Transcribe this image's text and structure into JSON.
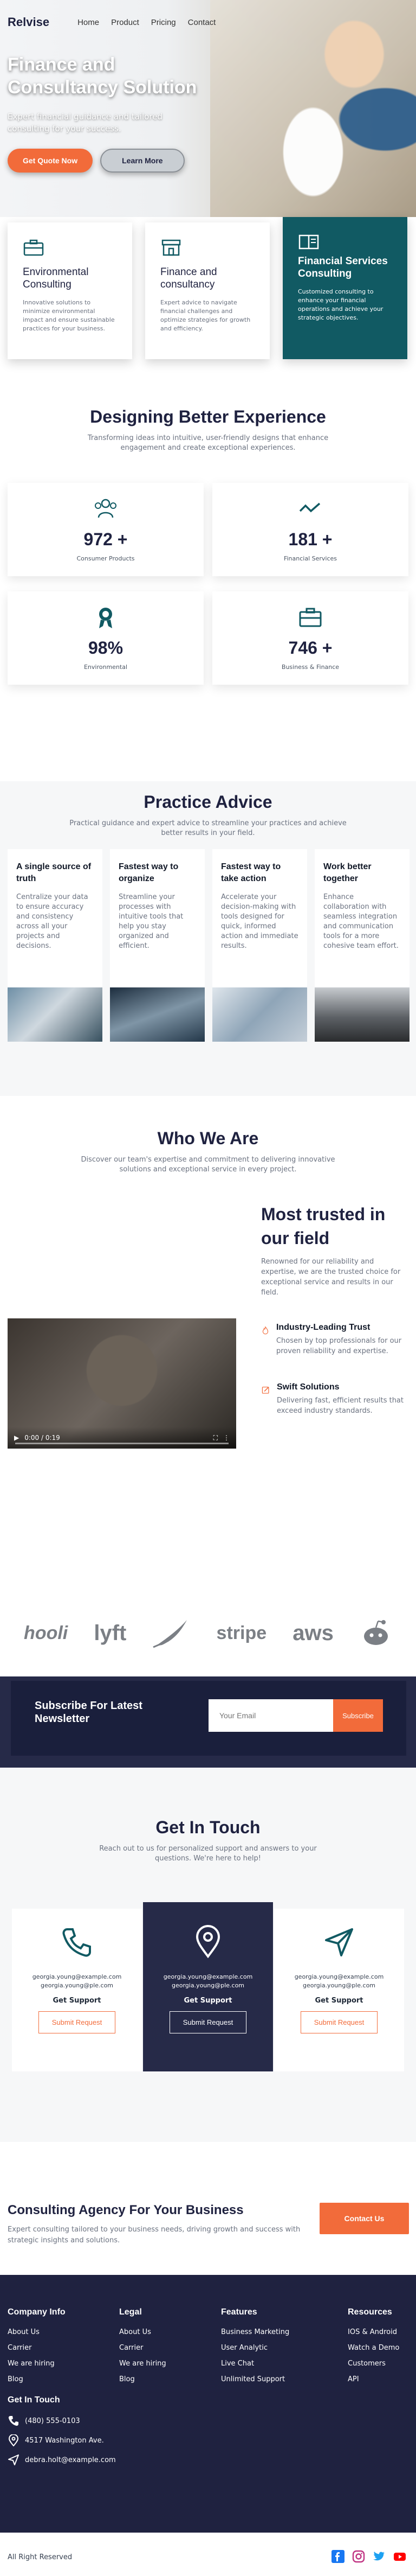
{
  "colors": {
    "navy": "#1f2240",
    "orange": "#f26b3a",
    "teal": "#115a63"
  },
  "header": {
    "logo": "Relvise",
    "nav": [
      "Home",
      "Product",
      "Pricing",
      "Contact"
    ]
  },
  "hero": {
    "title": "Finance and Consultancy Solution",
    "subtitle": "Expert financial guidance and tailored consulting for your success.",
    "primary_button": "Get Quote Now",
    "secondary_button": "Learn More"
  },
  "services": [
    {
      "icon": "briefcase-icon",
      "title": "Environmental Consulting",
      "text": "Innovative solutions to minimize environmental impact and ensure sustainable practices for your business."
    },
    {
      "icon": "store-icon",
      "title": "Finance and consultancy",
      "text": "Expert advice to navigate financial challenges and optimize strategies for growth and efficiency."
    },
    {
      "icon": "book-icon",
      "title": "Financial Services Consulting",
      "text": "Customized consulting to enhance your financial operations and achieve your strategic objectives."
    }
  ],
  "stats_section": {
    "title": "Designing Better Experience",
    "subtitle": "Transforming ideas into intuitive, user-friendly designs that enhance engagement and create exceptional experiences.",
    "stats": [
      {
        "icon": "users-icon",
        "value": "972 +",
        "label": "Consumer Products"
      },
      {
        "icon": "trend-icon",
        "value": "181 +",
        "label": "Financial Services"
      },
      {
        "icon": "award-icon",
        "value": "98%",
        "label": "Environmental"
      },
      {
        "icon": "briefcase-icon",
        "value": "746 +",
        "label": "Business & Finance"
      }
    ]
  },
  "practice": {
    "title": "Practice Advice",
    "subtitle": "Practical guidance and expert advice to streamline your practices and achieve better results in your field.",
    "cards": [
      {
        "title": "A single source of truth",
        "text": "Centralize your data to ensure accuracy and consistency across all your projects and decisions."
      },
      {
        "title": "Fastest way to organize",
        "text": "Streamline your processes with intuitive tools that help you stay organized and efficient."
      },
      {
        "title": "Fastest way to take action",
        "text": "Accelerate your decision-making with tools designed for quick, informed action and immediate results."
      },
      {
        "title": "Work better together",
        "text": "Enhance collaboration with seamless integration and communication tools for a more cohesive team effort."
      }
    ]
  },
  "who": {
    "title": "Who We Are",
    "subtitle": "Discover our team's expertise and commitment to delivering innovative solutions and exceptional service in every project.",
    "video_time": "0:00 / 0:19",
    "trust_title": "Most trusted in our field",
    "trust_text": "Renowned for our reliability and expertise, we are the trusted choice for exceptional service and results in our field.",
    "features": [
      {
        "icon": "flame-icon",
        "title": "Industry-Leading Trust",
        "text": "Chosen by top professionals for our proven reliability and expertise."
      },
      {
        "icon": "pencil-icon",
        "title": "Swift Solutions",
        "text": "Delivering fast, efficient results that exceed industry standards."
      }
    ]
  },
  "logos": [
    "hooli",
    "lyft",
    "feather",
    "stripe",
    "aws",
    "reddit"
  ],
  "newsletter": {
    "title": "Subscribe For Latest Newsletter",
    "placeholder": "Your Email",
    "button": "Subscribe"
  },
  "contact": {
    "title": "Get In Touch",
    "subtitle": "Reach out to us for personalized support and answers to your questions. We're here to help!",
    "cards": [
      {
        "icon": "phone-icon",
        "email1": "georgia.young@example.com",
        "email2": "georgia.young@ple.com",
        "label": "Get Support",
        "button": "Submit Request"
      },
      {
        "icon": "location-icon",
        "email1": "georgia.young@example.com",
        "email2": "georgia.young@ple.com",
        "label": "Get Support",
        "button": "Submit Request"
      },
      {
        "icon": "send-icon",
        "email1": "georgia.young@example.com",
        "email2": "georgia.young@ple.com",
        "label": "Get Support",
        "button": "Submit Request"
      }
    ]
  },
  "cta": {
    "title": "Consulting Agency For Your Business",
    "text": "Expert consulting tailored to your business needs, driving growth and success with strategic insights and solutions.",
    "button": "Contact Us"
  },
  "footer": {
    "columns": [
      {
        "title": "Company Info",
        "links": [
          "About Us",
          "Carrier",
          "We are hiring",
          "Blog"
        ]
      },
      {
        "title": "Legal",
        "links": [
          "About Us",
          "Carrier",
          "We are hiring",
          "Blog"
        ]
      },
      {
        "title": "Features",
        "links": [
          "Business Marketing",
          "User Analytic",
          "Live Chat",
          "Unlimited Support"
        ]
      },
      {
        "title": "Resources",
        "links": [
          "IOS & Android",
          "Watch a Demo",
          "Customers",
          "API"
        ]
      }
    ],
    "contact_title": "Get In Touch",
    "phone": "(480) 555-0103",
    "address": "4517 Washington Ave.",
    "email": "debra.holt@example.com"
  },
  "bottom": {
    "copyright": "All Right Reserved",
    "socials": [
      "facebook-icon",
      "instagram-icon",
      "twitter-icon",
      "youtube-icon"
    ]
  }
}
